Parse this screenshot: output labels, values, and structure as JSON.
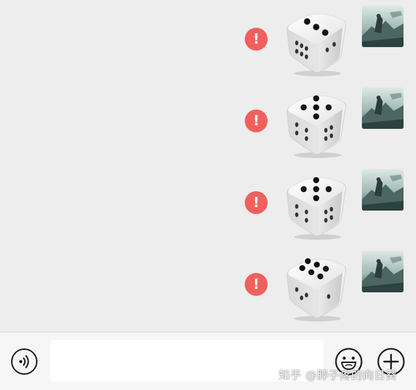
{
  "colors": {
    "chat_background": "#ededed",
    "error_badge": "#f0605c",
    "bottom_bar": "#f6f6f6",
    "icon_stroke": "#1b1b1b"
  },
  "messages": [
    {
      "type": "dice",
      "face": 3,
      "status": "failed",
      "status_glyph": "!"
    },
    {
      "type": "dice",
      "face": 5,
      "status": "failed",
      "status_glyph": "!"
    },
    {
      "type": "dice",
      "face": 5,
      "status": "failed",
      "status_glyph": "!"
    },
    {
      "type": "dice",
      "face": 6,
      "status": "failed",
      "status_glyph": "!"
    }
  ],
  "input_bar": {
    "voice_icon": "voice-icon",
    "message_value": "",
    "emoji_icon": "emoji-icon",
    "plus_icon": "plus-icon"
  },
  "watermark": "知乎 @脖子疼的向日葵"
}
